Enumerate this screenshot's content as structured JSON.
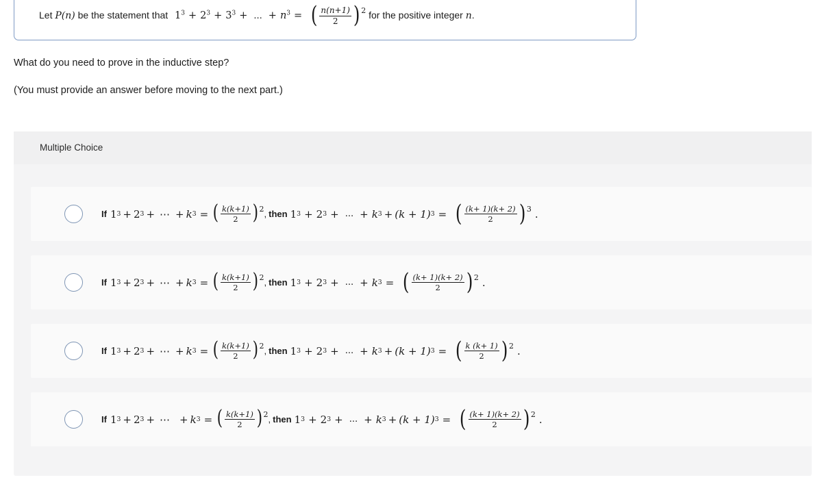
{
  "stem": {
    "prefix": "Let ",
    "statement_fn": "P(n)",
    "middle": " be the statement that ",
    "sum_terms": [
      "1",
      "2",
      "3"
    ],
    "sum_exponent": "3",
    "ellipsis": "...",
    "last_term": "n",
    "equals": "=",
    "fraction_numerator": "n(n+1)",
    "fraction_denominator": "2",
    "outer_exponent": "2",
    "suffix": " for the positive integer ",
    "variable": "n",
    "period": "."
  },
  "prompt": {
    "question": "What do you need to prove in the inductive step?",
    "note": "(You must provide an answer before moving to the next part.)"
  },
  "multiple_choice": {
    "header_label": "Multiple Choice",
    "options": [
      {
        "id": "option-a",
        "if_label": "If",
        "then_label": ", then",
        "hypothesis": {
          "terms": [
            "1",
            "2"
          ],
          "term_exponent": "3",
          "ellipsis": "⋯",
          "last_term": "k",
          "numerator": "k(k+1)",
          "denominator": "2",
          "outer_exponent": "2"
        },
        "conclusion": {
          "terms": [
            "1",
            "2"
          ],
          "term_exponent": "3",
          "ellipsis": "...",
          "k_term": "k",
          "extra_term": "(k + 1)",
          "extra_exponent": "3",
          "numerator": "(k+ 1)(k+ 2)",
          "denominator": "2",
          "outer_exponent": "3",
          "has_extra_term": true
        },
        "period": "."
      },
      {
        "id": "option-b",
        "if_label": "If",
        "then_label": ", then",
        "hypothesis": {
          "terms": [
            "1",
            "2"
          ],
          "term_exponent": "3",
          "ellipsis": "⋯",
          "last_term": "k",
          "numerator": "k(k+1)",
          "denominator": "2",
          "outer_exponent": "2"
        },
        "conclusion": {
          "terms": [
            "1",
            "2"
          ],
          "term_exponent": "3",
          "ellipsis": "...",
          "k_term": "k",
          "extra_term": "",
          "extra_exponent": "",
          "numerator": "(k+ 1)(k+ 2)",
          "denominator": "2",
          "outer_exponent": "2",
          "has_extra_term": false
        },
        "period": "."
      },
      {
        "id": "option-c",
        "if_label": "If",
        "then_label": ", then",
        "hypothesis": {
          "terms": [
            "1",
            "2"
          ],
          "term_exponent": "3",
          "ellipsis": "⋯",
          "last_term": "k",
          "numerator": "k(k+1)",
          "denominator": "2",
          "outer_exponent": "2"
        },
        "conclusion": {
          "terms": [
            "1",
            "2"
          ],
          "term_exponent": "3",
          "ellipsis": "...",
          "k_term": "k",
          "extra_term": "(k + 1)",
          "extra_exponent": "3",
          "numerator": "k (k+ 1)",
          "denominator": "2",
          "outer_exponent": "2",
          "has_extra_term": true
        },
        "period": "."
      },
      {
        "id": "option-d",
        "if_label": "If",
        "then_label": ", then",
        "hypothesis": {
          "terms": [
            "1",
            "2"
          ],
          "term_exponent": "3",
          "ellipsis": "⋯",
          "last_term": "k",
          "numerator": "k(k+1)",
          "denominator": "2",
          "outer_exponent": "2"
        },
        "conclusion": {
          "terms": [
            "1",
            "2"
          ],
          "term_exponent": "3",
          "ellipsis": "...",
          "k_term": "k",
          "extra_term": "(k + 1)",
          "extra_exponent": "3",
          "numerator": "(k+ 1)(k+ 2)",
          "denominator": "2",
          "outer_exponent": "2",
          "has_extra_term": true
        },
        "period": "."
      }
    ]
  },
  "colors": {
    "stem_border": "#7e9ac4",
    "panel_background": "#f4f4f5",
    "header_background": "#f0f0f1",
    "row_background": "#fafafa",
    "radio_border": "#7e95b4",
    "text": "#1b1b1b"
  }
}
